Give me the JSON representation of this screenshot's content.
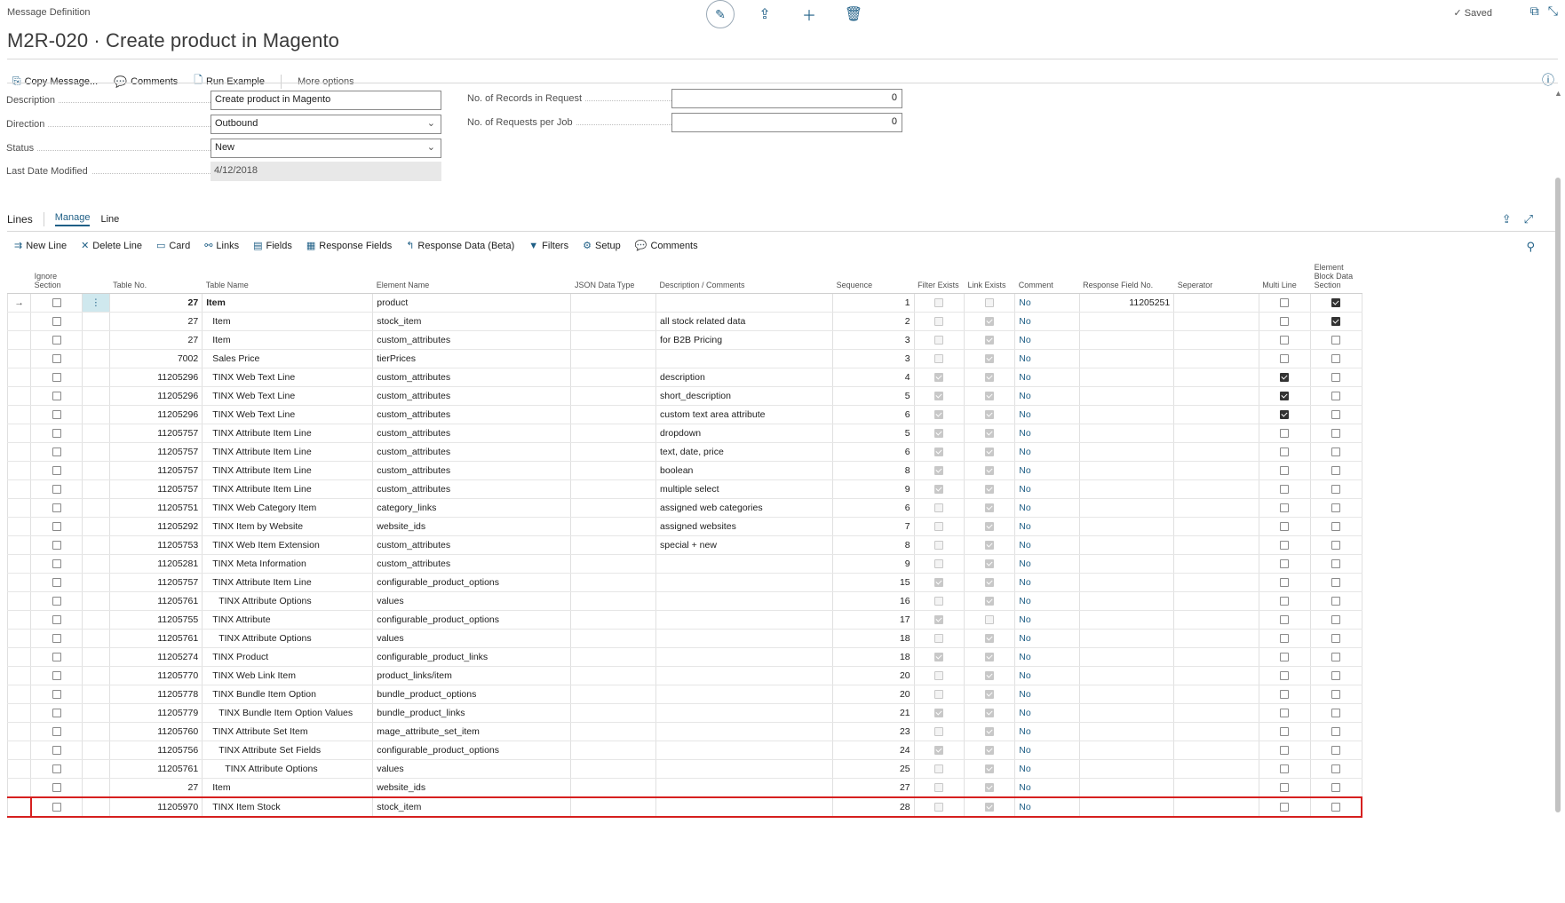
{
  "header": {
    "breadcrumb": "Message Definition",
    "title": "M2R-020 · Create product in Magento",
    "saved_label": "Saved"
  },
  "actions": {
    "copy_message": "Copy Message...",
    "comments": "Comments",
    "run_example": "Run Example",
    "more_options": "More options"
  },
  "fields": {
    "description": {
      "label": "Description",
      "value": "Create product in Magento"
    },
    "direction": {
      "label": "Direction",
      "value": "Outbound"
    },
    "status": {
      "label": "Status",
      "value": "New"
    },
    "last_date_modified": {
      "label": "Last Date Modified",
      "value": "4/12/2018"
    },
    "records_in_request": {
      "label": "No. of Records in Request",
      "value": "0"
    },
    "requests_per_job": {
      "label": "No. of Requests per Job",
      "value": "0"
    }
  },
  "lines": {
    "title": "Lines",
    "tabs": [
      "Manage",
      "Line"
    ],
    "toolbar": {
      "new_line": "New Line",
      "delete_line": "Delete Line",
      "card": "Card",
      "links": "Links",
      "fields": "Fields",
      "response_fields": "Response Fields",
      "response_data": "Response Data (Beta)",
      "filters": "Filters",
      "setup": "Setup",
      "comments": "Comments"
    },
    "columns": {
      "ignore_section": "Ignore Section",
      "table_no": "Table No.",
      "table_name": "Table Name",
      "element_name": "Element Name",
      "json_data_type": "JSON Data Type",
      "description": "Description / Comments",
      "sequence": "Sequence",
      "filter_exists": "Filter Exists",
      "link_exists": "Link Exists",
      "comment": "Comment",
      "response_field_no": "Response Field No.",
      "separator": "Seperator",
      "multi_line": "Multi Line",
      "element_block": "Element Block Data Section"
    },
    "rows": [
      {
        "table_no": "27",
        "table_name": "Item",
        "indent": 0,
        "element": "product",
        "desc": "",
        "seq": "1",
        "filter": false,
        "link": false,
        "comment": "No",
        "resp": "11205251",
        "multi": false,
        "block": true,
        "current": true
      },
      {
        "table_no": "27",
        "table_name": "Item",
        "indent": 1,
        "element": "stock_item",
        "desc": "all stock related data",
        "seq": "2",
        "filter": false,
        "link": true,
        "comment": "No",
        "resp": "",
        "multi": false,
        "block": true
      },
      {
        "table_no": "27",
        "table_name": "Item",
        "indent": 1,
        "element": "custom_attributes",
        "desc": "for B2B Pricing",
        "seq": "3",
        "filter": false,
        "link": true,
        "comment": "No",
        "resp": "",
        "multi": false,
        "block": false
      },
      {
        "table_no": "7002",
        "table_name": "Sales Price",
        "indent": 1,
        "element": "tierPrices",
        "desc": "",
        "seq": "3",
        "filter": false,
        "link": true,
        "comment": "No",
        "resp": "",
        "multi": false,
        "block": false
      },
      {
        "table_no": "11205296",
        "table_name": "TINX Web Text Line",
        "indent": 1,
        "element": "custom_attributes",
        "desc": "description",
        "seq": "4",
        "filter": true,
        "link": true,
        "comment": "No",
        "resp": "",
        "multi": true,
        "block": false
      },
      {
        "table_no": "11205296",
        "table_name": "TINX Web Text Line",
        "indent": 1,
        "element": "custom_attributes",
        "desc": "short_description",
        "seq": "5",
        "filter": true,
        "link": true,
        "comment": "No",
        "resp": "",
        "multi": true,
        "block": false
      },
      {
        "table_no": "11205296",
        "table_name": "TINX Web Text Line",
        "indent": 1,
        "element": "custom_attributes",
        "desc": "custom text area attribute",
        "seq": "6",
        "filter": true,
        "link": true,
        "comment": "No",
        "resp": "",
        "multi": true,
        "block": false
      },
      {
        "table_no": "11205757",
        "table_name": "TINX Attribute Item Line",
        "indent": 1,
        "element": "custom_attributes",
        "desc": "dropdown",
        "seq": "5",
        "filter": true,
        "link": true,
        "comment": "No",
        "resp": "",
        "multi": false,
        "block": false
      },
      {
        "table_no": "11205757",
        "table_name": "TINX Attribute Item Line",
        "indent": 1,
        "element": "custom_attributes",
        "desc": "text, date, price",
        "seq": "6",
        "filter": true,
        "link": true,
        "comment": "No",
        "resp": "",
        "multi": false,
        "block": false
      },
      {
        "table_no": "11205757",
        "table_name": "TINX Attribute Item Line",
        "indent": 1,
        "element": "custom_attributes",
        "desc": "boolean",
        "seq": "8",
        "filter": true,
        "link": true,
        "comment": "No",
        "resp": "",
        "multi": false,
        "block": false
      },
      {
        "table_no": "11205757",
        "table_name": "TINX Attribute Item Line",
        "indent": 1,
        "element": "custom_attributes",
        "desc": "multiple select",
        "seq": "9",
        "filter": true,
        "link": true,
        "comment": "No",
        "resp": "",
        "multi": false,
        "block": false
      },
      {
        "table_no": "11205751",
        "table_name": "TINX Web Category Item",
        "indent": 1,
        "element": "category_links",
        "desc": "assigned web categories",
        "seq": "6",
        "filter": false,
        "link": true,
        "comment": "No",
        "resp": "",
        "multi": false,
        "block": false
      },
      {
        "table_no": "11205292",
        "table_name": "TINX Item by Website",
        "indent": 1,
        "element": "website_ids",
        "desc": "assigned websites",
        "seq": "7",
        "filter": false,
        "link": true,
        "comment": "No",
        "resp": "",
        "multi": false,
        "block": false
      },
      {
        "table_no": "11205753",
        "table_name": "TINX Web Item Extension",
        "indent": 1,
        "element": "custom_attributes",
        "desc": "special + new",
        "seq": "8",
        "filter": false,
        "link": true,
        "comment": "No",
        "resp": "",
        "multi": false,
        "block": false
      },
      {
        "table_no": "11205281",
        "table_name": "TINX Meta Information",
        "indent": 1,
        "element": "custom_attributes",
        "desc": "",
        "seq": "9",
        "filter": false,
        "link": true,
        "comment": "No",
        "resp": "",
        "multi": false,
        "block": false
      },
      {
        "table_no": "11205757",
        "table_name": "TINX Attribute Item Line",
        "indent": 1,
        "element": "configurable_product_options",
        "desc": "",
        "seq": "15",
        "filter": true,
        "link": true,
        "comment": "No",
        "resp": "",
        "multi": false,
        "block": false
      },
      {
        "table_no": "11205761",
        "table_name": "TINX Attribute Options",
        "indent": 2,
        "element": "values",
        "desc": "",
        "seq": "16",
        "filter": false,
        "link": true,
        "comment": "No",
        "resp": "",
        "multi": false,
        "block": false
      },
      {
        "table_no": "11205755",
        "table_name": "TINX Attribute",
        "indent": 1,
        "element": "configurable_product_options",
        "desc": "",
        "seq": "17",
        "filter": true,
        "link": false,
        "comment": "No",
        "resp": "",
        "multi": false,
        "block": false
      },
      {
        "table_no": "11205761",
        "table_name": "TINX Attribute Options",
        "indent": 2,
        "element": "values",
        "desc": "",
        "seq": "18",
        "filter": false,
        "link": true,
        "comment": "No",
        "resp": "",
        "multi": false,
        "block": false
      },
      {
        "table_no": "11205274",
        "table_name": "TINX Product",
        "indent": 1,
        "element": "configurable_product_links",
        "desc": "",
        "seq": "18",
        "filter": true,
        "link": true,
        "comment": "No",
        "resp": "",
        "multi": false,
        "block": false
      },
      {
        "table_no": "11205770",
        "table_name": "TINX Web Link Item",
        "indent": 1,
        "element": "product_links/item",
        "desc": "",
        "seq": "20",
        "filter": false,
        "link": true,
        "comment": "No",
        "resp": "",
        "multi": false,
        "block": false
      },
      {
        "table_no": "11205778",
        "table_name": "TINX Bundle Item Option",
        "indent": 1,
        "element": "bundle_product_options",
        "desc": "",
        "seq": "20",
        "filter": false,
        "link": true,
        "comment": "No",
        "resp": "",
        "multi": false,
        "block": false
      },
      {
        "table_no": "11205779",
        "table_name": "TINX Bundle Item Option Values",
        "indent": 2,
        "element": "bundle_product_links",
        "desc": "",
        "seq": "21",
        "filter": true,
        "link": true,
        "comment": "No",
        "resp": "",
        "multi": false,
        "block": false
      },
      {
        "table_no": "11205760",
        "table_name": "TINX Attribute Set Item",
        "indent": 1,
        "element": "mage_attribute_set_item",
        "desc": "",
        "seq": "23",
        "filter": false,
        "link": true,
        "comment": "No",
        "resp": "",
        "multi": false,
        "block": false
      },
      {
        "table_no": "11205756",
        "table_name": "TINX Attribute Set Fields",
        "indent": 2,
        "element": "configurable_product_options",
        "desc": "",
        "seq": "24",
        "filter": true,
        "link": true,
        "comment": "No",
        "resp": "",
        "multi": false,
        "block": false
      },
      {
        "table_no": "11205761",
        "table_name": "TINX Attribute Options",
        "indent": 3,
        "element": "values",
        "desc": "",
        "seq": "25",
        "filter": false,
        "link": true,
        "comment": "No",
        "resp": "",
        "multi": false,
        "block": false
      },
      {
        "table_no": "27",
        "table_name": "Item",
        "indent": 1,
        "element": "website_ids",
        "desc": "",
        "seq": "27",
        "filter": false,
        "link": true,
        "comment": "No",
        "resp": "",
        "multi": false,
        "block": false
      },
      {
        "table_no": "11205970",
        "table_name": "TINX Item Stock",
        "indent": 1,
        "element": "stock_item",
        "desc": "",
        "seq": "28",
        "filter": false,
        "link": true,
        "comment": "No",
        "resp": "",
        "multi": false,
        "block": false,
        "highlight": true
      }
    ]
  },
  "colors": {
    "accent": "#1f5f86",
    "highlight_border": "#d6201f",
    "selected_cell": "#cfe8ee"
  },
  "icons": [
    "edit-icon",
    "share-icon",
    "add-icon",
    "delete-icon",
    "open-new-window-icon",
    "collapse-icon",
    "info-icon"
  ]
}
